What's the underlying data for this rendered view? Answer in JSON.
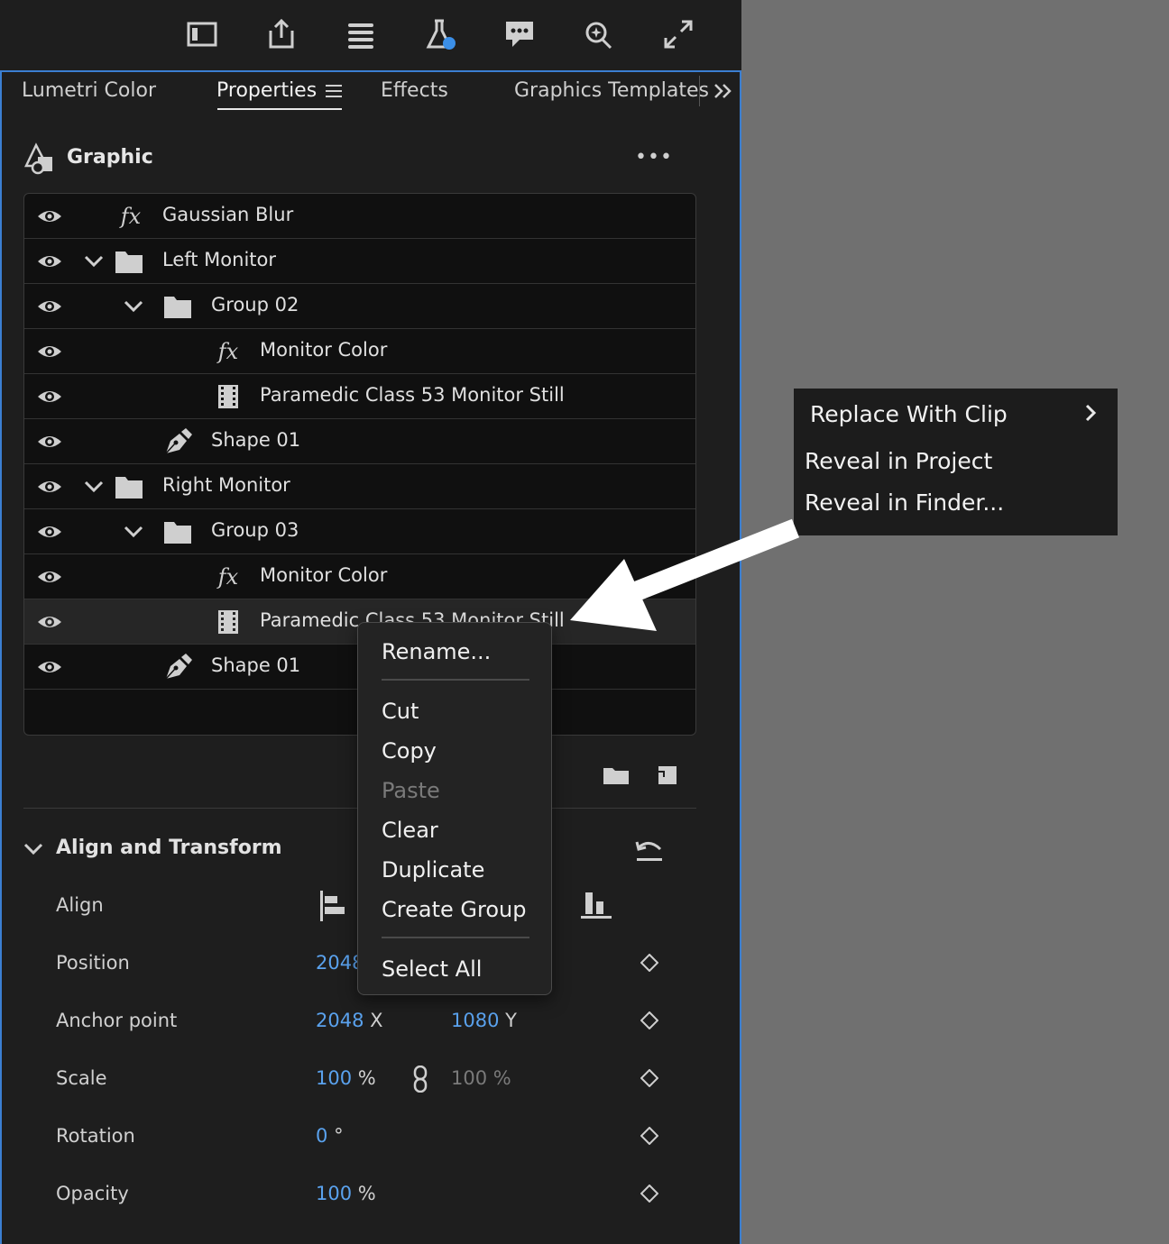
{
  "tabs": [
    {
      "label": "Lumetri Color"
    },
    {
      "label": "Properties"
    },
    {
      "label": "Effects"
    },
    {
      "label": "Graphics Templates"
    }
  ],
  "active_tab": "Properties",
  "graphic": {
    "title": "Graphic",
    "more_label": "•••"
  },
  "layers": [
    {
      "name": "Gaussian Blur",
      "type": "fx"
    },
    {
      "name": "Left Monitor",
      "type": "folder",
      "expanded": true
    },
    {
      "name": "Group 02",
      "type": "folder",
      "expanded": true
    },
    {
      "name": "Monitor Color",
      "type": "fx"
    },
    {
      "name": "Paramedic Class 53 Monitor Still",
      "type": "clip"
    },
    {
      "name": "Shape 01",
      "type": "shape"
    },
    {
      "name": "Right Monitor",
      "type": "folder",
      "expanded": true
    },
    {
      "name": "Group 03",
      "type": "folder",
      "expanded": true
    },
    {
      "name": "Monitor Color",
      "type": "fx"
    },
    {
      "name": "Paramedic Class 53 Monitor Still",
      "type": "clip",
      "selected": true
    },
    {
      "name": "Shape 01",
      "type": "shape"
    }
  ],
  "align_transform": {
    "title": "Align and Transform",
    "align_label": "Align",
    "position": {
      "label": "Position",
      "x": "2048"
    },
    "anchor_point": {
      "label": "Anchor point",
      "x": "2048",
      "x_unit": "X",
      "y": "1080",
      "y_unit": "Y"
    },
    "scale": {
      "label": "Scale",
      "value": "100",
      "unit": "%",
      "linked_value": "100 %"
    },
    "rotation": {
      "label": "Rotation",
      "value": "0",
      "unit": "°"
    },
    "opacity": {
      "label": "Opacity",
      "value": "100",
      "unit": "%"
    }
  },
  "context_menu": {
    "rename": "Rename...",
    "cut": "Cut",
    "copy": "Copy",
    "paste": "Paste",
    "clear": "Clear",
    "duplicate": "Duplicate",
    "create_group": "Create Group",
    "select_all": "Select All"
  },
  "submenu": {
    "replace": "Replace With Clip",
    "reveal_project": "Reveal in Project",
    "reveal_finder": "Reveal in Finder..."
  },
  "colors": {
    "accent": "#3b7fd1",
    "value_blue": "#5aa2ee",
    "panel_bg": "#1e1e1e",
    "canvas_bg": "#707070"
  },
  "toolbar_icons": [
    "panel-layout-icon",
    "export-icon",
    "lines-icon",
    "beaker-icon",
    "captions-icon",
    "search-sparkle-icon",
    "fullscreen-icon"
  ]
}
